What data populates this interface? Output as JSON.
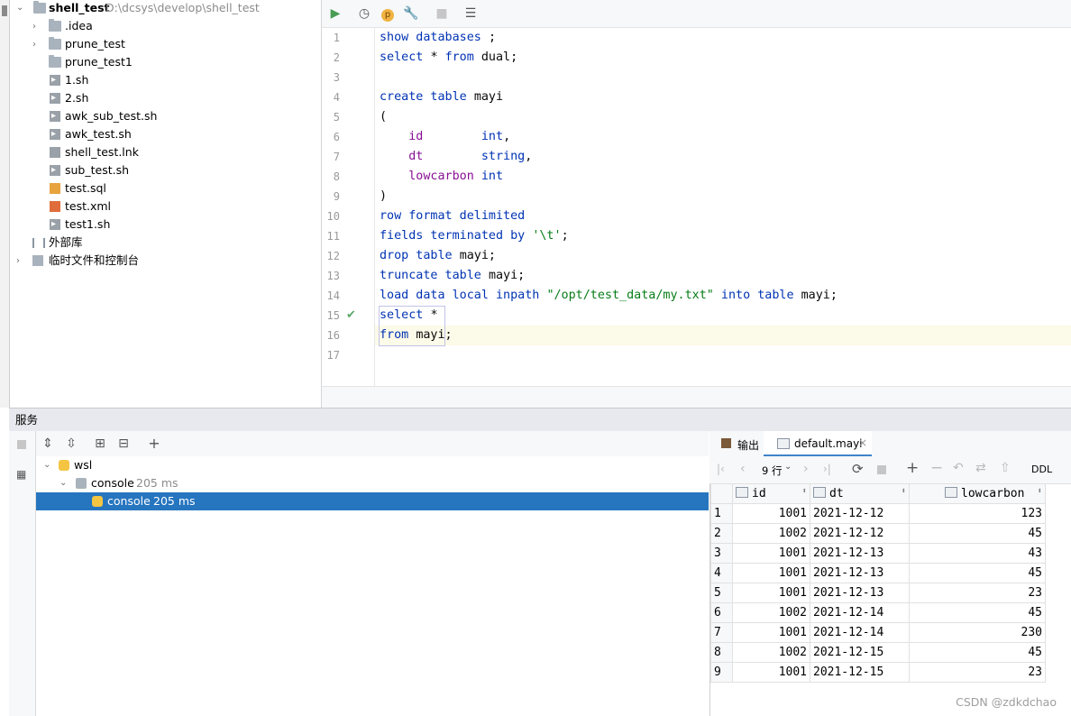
{
  "project": {
    "root_name": "shell_test",
    "root_path": "D:\\dcsys\\develop\\shell_test",
    "items": [
      {
        "label": ".idea",
        "kind": "folder",
        "expandable": true
      },
      {
        "label": "prune_test",
        "kind": "folder",
        "expandable": true
      },
      {
        "label": "prune_test1",
        "kind": "folder",
        "expandable": false
      },
      {
        "label": "1.sh",
        "kind": "shell-file"
      },
      {
        "label": "2.sh",
        "kind": "shell-file"
      },
      {
        "label": "awk_sub_test.sh",
        "kind": "shell-file"
      },
      {
        "label": "awk_test.sh",
        "kind": "shell-file"
      },
      {
        "label": "shell_test.lnk",
        "kind": "unknown-file"
      },
      {
        "label": "sub_test.sh",
        "kind": "shell-file"
      },
      {
        "label": "test.sql",
        "kind": "sql-file"
      },
      {
        "label": "test.xml",
        "kind": "xml-file"
      },
      {
        "label": "test1.sh",
        "kind": "shell-file"
      }
    ],
    "external_libs": "外部库",
    "scratches": "临时文件和控制台"
  },
  "editor": {
    "line_numbers": [
      "1",
      "2",
      "3",
      "4",
      "5",
      "6",
      "7",
      "8",
      "9",
      "10",
      "11",
      "12",
      "13",
      "14",
      "15",
      "16",
      "17"
    ],
    "lines": [
      [
        [
          "kw",
          "show databases "
        ],
        [
          "",
          "; "
        ]
      ],
      [
        [
          "kw",
          "select "
        ],
        [
          "",
          "* "
        ],
        [
          "kw",
          "from "
        ],
        [
          "",
          "dual;"
        ]
      ],
      [],
      [
        [
          "kw",
          "create table "
        ],
        [
          "",
          "mayi"
        ]
      ],
      [
        [
          "",
          "("
        ]
      ],
      [
        [
          "",
          "    "
        ],
        [
          "fld",
          "id"
        ],
        [
          "",
          "        "
        ],
        [
          "kw",
          "int"
        ],
        [
          "",
          ","
        ]
      ],
      [
        [
          "",
          "    "
        ],
        [
          "fld",
          "dt"
        ],
        [
          "",
          "        "
        ],
        [
          "kw",
          "string"
        ],
        [
          "",
          ","
        ]
      ],
      [
        [
          "",
          "    "
        ],
        [
          "fld",
          "lowcarbon"
        ],
        [
          "",
          ""
        ],
        [
          "kw",
          " int"
        ]
      ],
      [
        [
          "",
          ")"
        ]
      ],
      [
        [
          "kw",
          "row format delimited"
        ]
      ],
      [
        [
          "kw",
          "fields terminated by "
        ],
        [
          "str",
          "'\\t'"
        ],
        [
          "",
          ";"
        ]
      ],
      [
        [
          "kw",
          "drop table "
        ],
        [
          "",
          "mayi;"
        ]
      ],
      [
        [
          "kw",
          "truncate table "
        ],
        [
          "",
          "mayi;"
        ]
      ],
      [
        [
          "kw",
          "load data local inpath "
        ],
        [
          "str",
          "\"/opt/test_data/my.txt\""
        ],
        [
          "kw",
          " into table "
        ],
        [
          "",
          "mayi;"
        ]
      ],
      [
        [
          "kw",
          "select "
        ],
        [
          "",
          "*"
        ]
      ],
      [
        [
          "kw",
          "from "
        ],
        [
          "",
          "mayi;"
        ]
      ],
      []
    ]
  },
  "services": {
    "title": "服务",
    "tree": [
      {
        "label": "wsl",
        "time": ""
      },
      {
        "label": "console",
        "time": "205 ms"
      },
      {
        "label": "console",
        "time": "205 ms"
      }
    ]
  },
  "results": {
    "tab_output": "输出",
    "tab_table": "default.mayi",
    "row_count": "9 行",
    "ddl_label": "DDL",
    "columns": [
      "id",
      "dt",
      "lowcarbon"
    ],
    "rows": [
      [
        "1",
        "1001",
        "2021-12-12",
        "123"
      ],
      [
        "2",
        "1002",
        "2021-12-12",
        "45"
      ],
      [
        "3",
        "1001",
        "2021-12-13",
        "43"
      ],
      [
        "4",
        "1001",
        "2021-12-13",
        "45"
      ],
      [
        "5",
        "1001",
        "2021-12-13",
        "23"
      ],
      [
        "6",
        "1002",
        "2021-12-14",
        "45"
      ],
      [
        "7",
        "1001",
        "2021-12-14",
        "230"
      ],
      [
        "8",
        "1002",
        "2021-12-15",
        "45"
      ],
      [
        "9",
        "1001",
        "2021-12-15",
        "23"
      ]
    ]
  },
  "watermark": "CSDN @zdkdchao"
}
